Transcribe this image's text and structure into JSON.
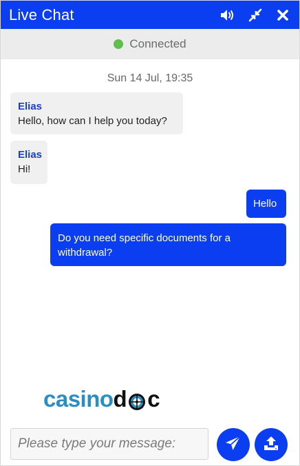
{
  "header": {
    "title": "Live Chat",
    "controls": [
      {
        "icon": "volume-icon"
      },
      {
        "icon": "minimize-icon"
      },
      {
        "icon": "close-icon"
      }
    ],
    "background": "#0b3ef1"
  },
  "status": {
    "text": "Connected",
    "dot_color": "#5ebf4f"
  },
  "chat": {
    "timestamp": "Sun 14 Jul, 19:35",
    "messages": [
      {
        "direction": "incoming",
        "sender": "Elias",
        "text": "Hello, how can I help you today?"
      },
      {
        "direction": "incoming",
        "sender": "Elias",
        "text": "Hi!"
      },
      {
        "direction": "outgoing",
        "text": "Hello"
      },
      {
        "direction": "outgoing",
        "text": "Do you need specific documents for a withdrawal?"
      }
    ]
  },
  "branding": {
    "logo_part1": "casino",
    "logo_part2": "d",
    "logo_part3": "c"
  },
  "composer": {
    "placeholder": "Please type your message:",
    "value": "",
    "send_icon": "send-icon",
    "upload_icon": "upload-icon"
  },
  "colors": {
    "accent": "#0b3ef1",
    "sender_name": "#1c3fbf",
    "incoming_bubble": "#f0f0f0"
  }
}
